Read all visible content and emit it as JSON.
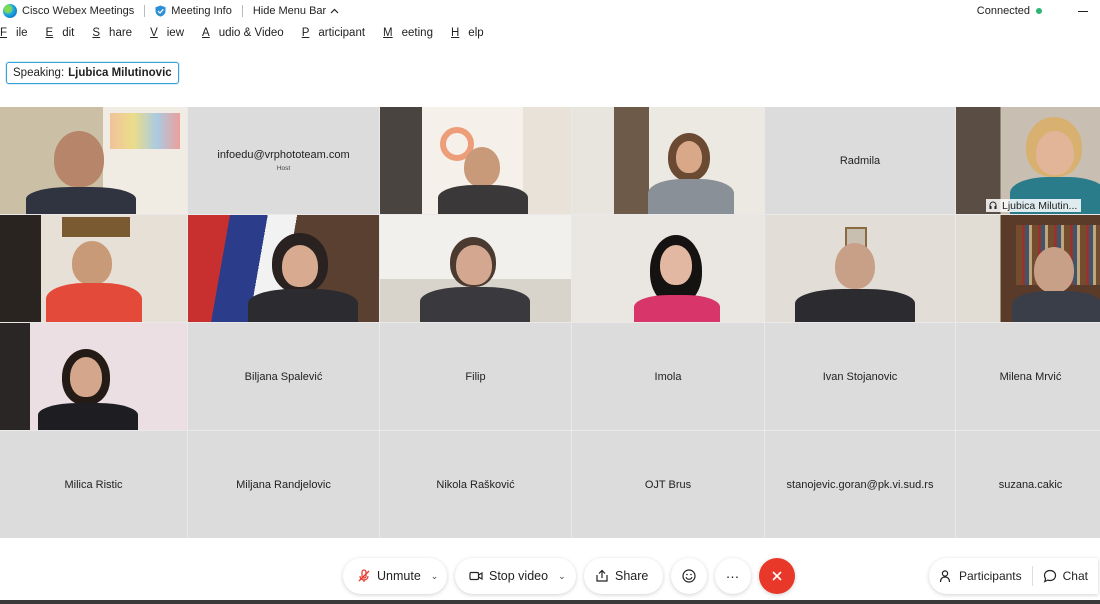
{
  "titlebar": {
    "app_name": "Cisco Webex Meetings",
    "meeting_info": "Meeting Info",
    "hide_menu": "Hide Menu Bar",
    "status": "Connected",
    "status_color": "#2bb673"
  },
  "menu": [
    {
      "key": "F",
      "rest": "ile"
    },
    {
      "key": "E",
      "rest": "dit"
    },
    {
      "key": "S",
      "rest": "hare"
    },
    {
      "key": "V",
      "rest": "iew"
    },
    {
      "key": "A",
      "rest": "udio & Video"
    },
    {
      "key": "P",
      "rest": "articipant"
    },
    {
      "key": "M",
      "rest": "eeting"
    },
    {
      "key": "H",
      "rest": "elp"
    }
  ],
  "speaking": {
    "label": "Speaking:",
    "name": "Ljubica Milutinovic"
  },
  "participants": {
    "host_name": "infoedu@vrphototeam.com",
    "host_tag": "Host",
    "radmila": "Radmila",
    "active_speaker_tag": "Ljubica Milutin...",
    "row3": [
      "Biljana Spalević",
      "Filip",
      "Imola",
      "Ivan Stojanovic",
      "Milena Mrvić"
    ],
    "row4": [
      "Milica Ristic",
      "Miljana Randjelovic",
      "Nikola Rašković",
      "OJT Brus",
      "stanojevic.goran@pk.vi.sud.rs",
      "suzana.cakic"
    ]
  },
  "controls": {
    "unmute": "Unmute",
    "stop_video": "Stop video",
    "share": "Share",
    "participants": "Participants",
    "chat": "Chat",
    "accent": "#3aa0d8",
    "leave_color": "#e8382a"
  }
}
